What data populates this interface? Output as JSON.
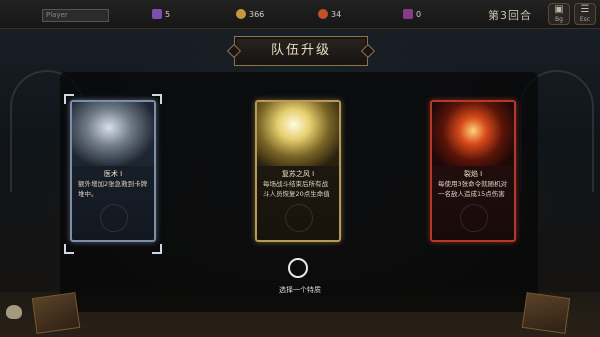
{
  "hud": {
    "player_placeholder": "Player",
    "stats": [
      {
        "icon": "potion-icon",
        "value": "5",
        "color": "#7a4fb0"
      },
      {
        "icon": "gold-coin-icon",
        "value": "366",
        "color": "#c49a3a"
      },
      {
        "icon": "fire-orb-icon",
        "value": "34",
        "color": "#c4502a"
      },
      {
        "icon": "gem-icon",
        "value": "0",
        "color": "#8a3a8a"
      }
    ],
    "round_label": "第3回合",
    "buttons": [
      {
        "icon": "bag-icon",
        "label": "Bg"
      },
      {
        "icon": "escape-icon",
        "label": "Esc"
      }
    ]
  },
  "dialog": {
    "title": "队伍升级",
    "select_label": "选择一个特质"
  },
  "cards": [
    {
      "name": "医术 I",
      "desc": "额外增加2张急救到卡牌堆中。",
      "selected": true
    },
    {
      "name": "复苏之风 I",
      "desc": "每场战斗结束后所有战斗人员恢复20点生命值",
      "selected": false
    },
    {
      "name": "裂焰 I",
      "desc": "每使用3张命令就随机对一名敌人造成15点伤害",
      "selected": false
    }
  ]
}
